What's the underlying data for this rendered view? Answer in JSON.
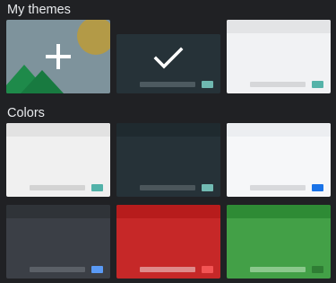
{
  "sections": {
    "my_themes": {
      "title": "My themes"
    },
    "colors": {
      "title": "Colors"
    }
  },
  "my_themes": [
    {
      "id": "add-theme",
      "icon": "plus-icon"
    },
    {
      "id": "theme-dark-selected",
      "icon": "check-icon",
      "selected": true,
      "colors": {
        "body": "#263238",
        "top": "#263238",
        "bar": "#4d5a60",
        "chip": "#6fb8b0"
      }
    },
    {
      "id": "theme-light",
      "colors": {
        "body": "#f1f2f4",
        "top": "#e3e4e6",
        "bar": "#d6d7d9",
        "chip": "#55b3a9"
      }
    }
  ],
  "colors": [
    {
      "id": "color-light-gray",
      "colors": {
        "body": "#f0f0f0",
        "top": "#e2e2e2",
        "bar": "#d3d3d3",
        "chip": "#52b2a9"
      }
    },
    {
      "id": "color-dark-slate",
      "colors": {
        "body": "#263238",
        "top": "#1f2a2f",
        "bar": "#4b565b",
        "chip": "#72bbb3"
      }
    },
    {
      "id": "color-white",
      "colors": {
        "body": "#f6f7f9",
        "top": "#eceef1",
        "bar": "#d8d9dc",
        "chip": "#1a73e8"
      }
    },
    {
      "id": "color-charcoal",
      "colors": {
        "body": "#3b3f46",
        "top": "#2f3338",
        "bar": "#5b6067",
        "chip": "#5a9af5"
      }
    },
    {
      "id": "color-red",
      "colors": {
        "body": "#c62828",
        "top": "#b71c1c",
        "bar": "#de8a8a",
        "chip": "#f35454"
      }
    },
    {
      "id": "color-green",
      "colors": {
        "body": "#43a047",
        "top": "#2e8b35",
        "bar": "#8bc88c",
        "chip": "#2f7d34"
      }
    }
  ]
}
